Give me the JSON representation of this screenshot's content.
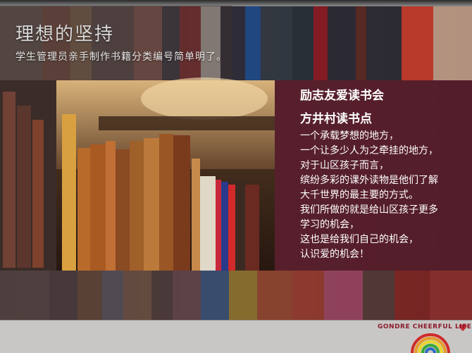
{
  "header": {
    "title": "理想的坚持",
    "subtitle": "学生管理员亲手制作书籍分类编号简单明了。"
  },
  "panel": {
    "heading1": "励志友爱读书会",
    "heading2": "方井村读书点",
    "lines": [
      "一个承载梦想的地方，",
      "一个让多少人为之牵挂的地方，",
      "对于山区孩子而言，",
      "缤纷多彩的课外读物是他们了解",
      "大千世界的最主要的方式。",
      "我们所做的就是给山区孩子更多",
      "学习的机会，",
      "这也是给我们自己的机会，",
      "认识爱的机会！"
    ]
  },
  "footer": {
    "brand": "GONDRE CHEERFUL LIFE"
  },
  "colors": {
    "panel": "#5a1e2e",
    "brand": "#8a1a2a",
    "heart": "#c8303a"
  }
}
